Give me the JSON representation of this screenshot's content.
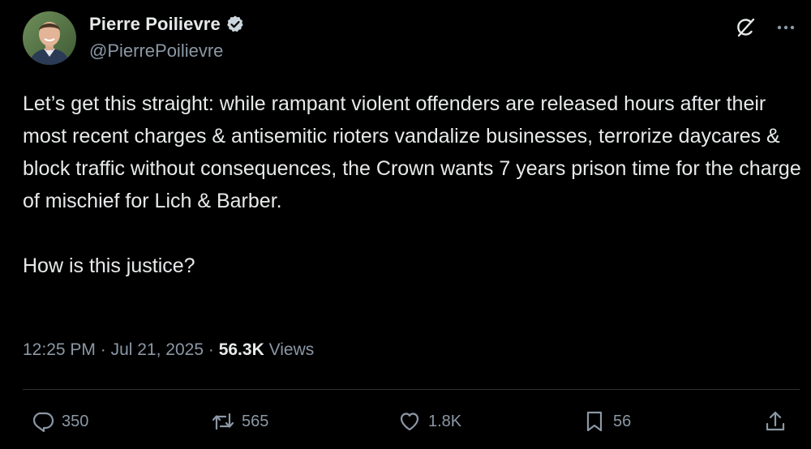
{
  "author": {
    "display_name": "Pierre Poilievre",
    "handle": "@PierrePoilievre",
    "verified": true
  },
  "post": {
    "paragraphs": [
      "Let’s get this straight: while rampant violent offenders are released hours after their most recent charges & antisemitic rioters vandalize businesses, terrorize daycares & block traffic without consequences, the Crown wants 7 years prison time for the charge of mischief for Lich & Barber.",
      "How is this justice?"
    ]
  },
  "meta": {
    "time": "12:25 PM",
    "separator": "·",
    "date": "Jul 21, 2025",
    "views_count": "56.3K",
    "views_label": "Views"
  },
  "actions": {
    "replies": "350",
    "reposts": "565",
    "likes": "1.8K",
    "bookmarks": "56"
  },
  "icons": {
    "verified": "verified-badge-icon",
    "grok": "grok-icon",
    "more": "more-options-icon",
    "reply": "reply-icon",
    "repost": "repost-icon",
    "like": "heart-icon",
    "bookmark": "bookmark-icon",
    "share": "share-icon"
  },
  "colors": {
    "background": "#000000",
    "primary_text": "#e7e9ea",
    "secondary_text": "#8b98a5",
    "divider": "#2f3336"
  }
}
